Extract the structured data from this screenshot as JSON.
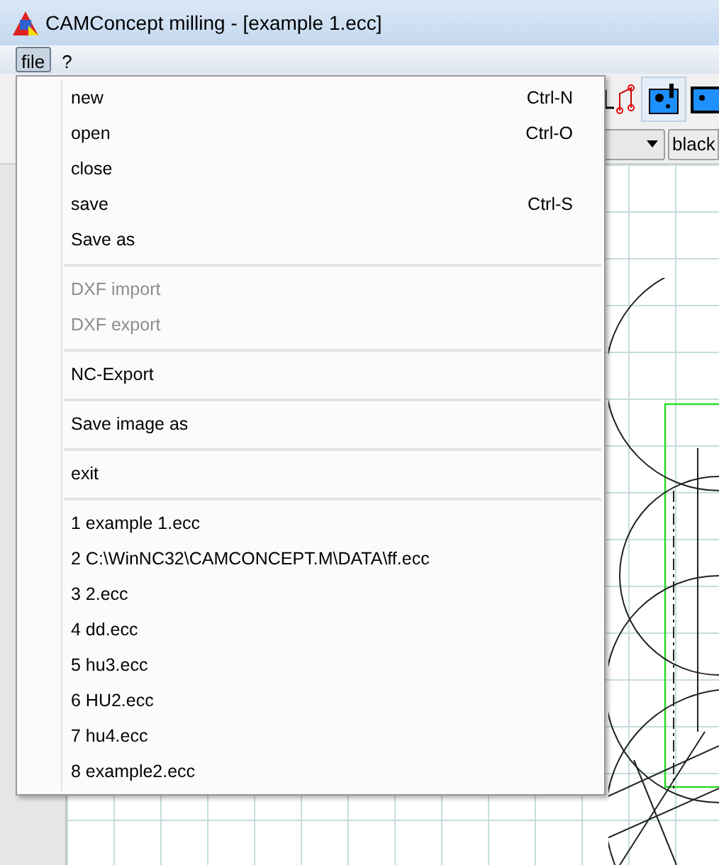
{
  "window": {
    "title": "CAMConcept milling - [example 1.ecc]"
  },
  "menu_bar": [
    {
      "label": "file",
      "selected": true
    },
    {
      "label": "?",
      "selected": false
    }
  ],
  "toolbar": {
    "color_button": "black"
  },
  "file_menu": [
    {
      "kind": "command",
      "label": "new",
      "shortcut": "Ctrl-N",
      "disabled": false
    },
    {
      "kind": "command",
      "label": "open",
      "shortcut": "Ctrl-O",
      "disabled": false
    },
    {
      "kind": "command",
      "label": "close",
      "disabled": false
    },
    {
      "kind": "command",
      "label": "save",
      "shortcut": "Ctrl-S",
      "disabled": false
    },
    {
      "kind": "command",
      "label": "Save as",
      "disabled": false
    },
    {
      "kind": "separator"
    },
    {
      "kind": "command",
      "label": "DXF import",
      "disabled": true
    },
    {
      "kind": "command",
      "label": "DXF export",
      "disabled": true
    },
    {
      "kind": "separator"
    },
    {
      "kind": "command",
      "label": "NC-Export",
      "disabled": false
    },
    {
      "kind": "separator"
    },
    {
      "kind": "command",
      "label": "Save image as",
      "disabled": false
    },
    {
      "kind": "separator"
    },
    {
      "kind": "command",
      "label": "exit",
      "disabled": false
    },
    {
      "kind": "separator"
    },
    {
      "kind": "command",
      "label": "1 example 1.ecc",
      "disabled": false
    },
    {
      "kind": "command",
      "label": "2 C:\\WinNC32\\CAMCONCEPT.M\\DATA\\ff.ecc",
      "disabled": false
    },
    {
      "kind": "command",
      "label": "3 2.ecc",
      "disabled": false
    },
    {
      "kind": "command",
      "label": "4 dd.ecc",
      "disabled": false
    },
    {
      "kind": "command",
      "label": "5 hu3.ecc",
      "disabled": false
    },
    {
      "kind": "command",
      "label": "6 HU2.ecc",
      "disabled": false
    },
    {
      "kind": "command",
      "label": "7 hu4.ecc",
      "disabled": false
    },
    {
      "kind": "command",
      "label": "8 example2.ecc",
      "disabled": false
    }
  ]
}
